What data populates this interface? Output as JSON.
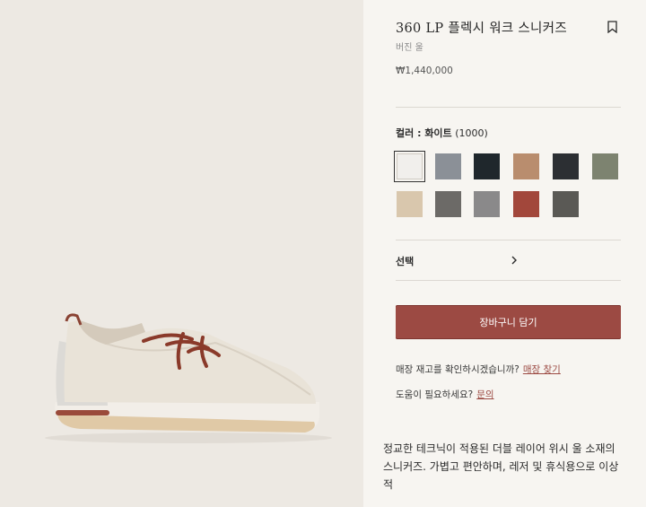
{
  "product": {
    "name": "360 LP 플렉시 워크 스니커즈",
    "material": "버진 울",
    "price": "₩1,440,000"
  },
  "colors": {
    "label": "컬러 : ",
    "selected_name": "화이트",
    "selected_code": "(1000)",
    "swatches": [
      {
        "name": "white",
        "color": "#f1efec"
      },
      {
        "name": "grey-blue",
        "color": "#8b9097"
      },
      {
        "name": "navy-black",
        "color": "#1f272c"
      },
      {
        "name": "tan",
        "color": "#b98d6e"
      },
      {
        "name": "charcoal-black",
        "color": "#2c2f33"
      },
      {
        "name": "olive",
        "color": "#7d8370"
      },
      {
        "name": "beige",
        "color": "#d9c7ad"
      },
      {
        "name": "grey-mix",
        "color": "#6c6a67"
      },
      {
        "name": "grey-melange",
        "color": "#8a898a"
      },
      {
        "name": "red-clay",
        "color": "#a2473b"
      },
      {
        "name": "dark-grey",
        "color": "#5a5955"
      }
    ]
  },
  "size_select": {
    "label": "선택"
  },
  "add_to_cart": "장바구니 담기",
  "store_check": {
    "text": "매장 재고를 확인하시겠습니까?",
    "link": "매장 찾기"
  },
  "help": {
    "text": "도움이 필요하세요?",
    "link": "문의"
  },
  "description": "정교한 테크닉이 적용된 더블 레이어 위시 울 소재의 스니커즈. 가볍고 편안하며, 레저 및 휴식용으로 이상적"
}
